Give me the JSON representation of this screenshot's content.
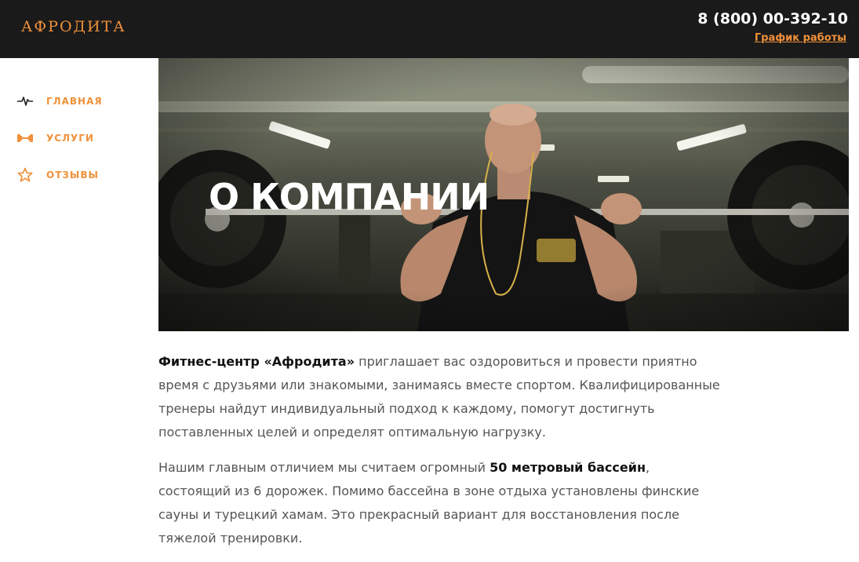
{
  "header": {
    "logo": "АФРОДИТА",
    "phone": "8 (800) 00-392-10",
    "schedule_link": "График работы"
  },
  "sidebar": {
    "items": [
      {
        "label": "ГЛАВНАЯ",
        "icon": "pulse-icon"
      },
      {
        "label": "УСЛУГИ",
        "icon": "dumbbell-icon"
      },
      {
        "label": "ОТЗЫВЫ",
        "icon": "star-icon"
      }
    ]
  },
  "hero": {
    "title": "О КОМПАНИИ"
  },
  "content": {
    "p1": {
      "bold": "Фитнес-центр «Афродита»",
      "rest": " приглашает вас оздоровиться и провести приятно время с друзьями или знакомыми, занимаясь вместе спортом. Квалифицированные тренеры найдут индивидуальный подход к каждому, помогут достигнуть поставленных целей и определят оптимальную нагрузку."
    },
    "p2": {
      "before": "Нашим главным отличием мы считаем огромный ",
      "bold": "50 метровый бассейн",
      "after": ", состоящий из 6 дорожек. Помимо бассейна в зоне отдыха установлены финские сауны и турецкий хамам. Это прекрасный вариант для восстановления после тяжелой тренировки."
    }
  },
  "colors": {
    "accent": "#f0913a",
    "header_bg": "#1a1a1a",
    "text": "#555555",
    "text_strong": "#111111"
  }
}
